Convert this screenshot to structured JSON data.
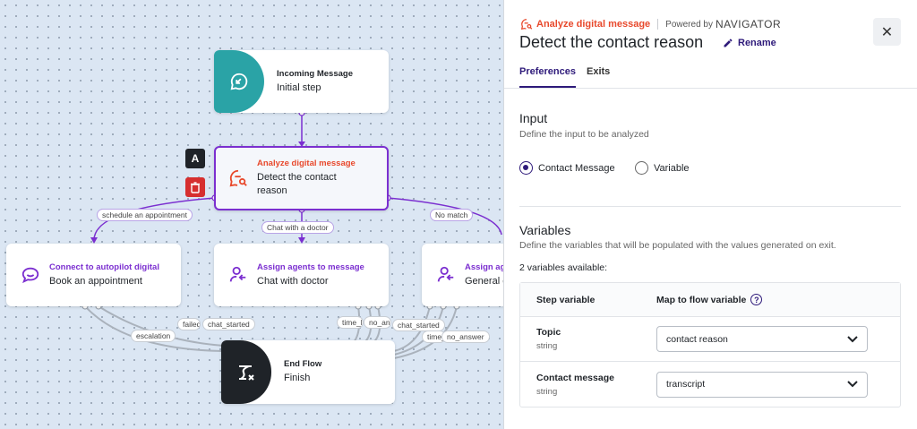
{
  "canvas": {
    "nodes": {
      "incoming": {
        "label": "Incoming Message",
        "title": "Initial step"
      },
      "analyze": {
        "label": "Analyze digital message",
        "title": "Detect the contact reason"
      },
      "autopilot": {
        "label": "Connect to autopilot digital",
        "title": "Book an appointment"
      },
      "assign_doctor": {
        "label": "Assign agents to message",
        "title": "Chat with doctor"
      },
      "assign_general": {
        "label": "Assign agents to message",
        "title": "General chat"
      },
      "end": {
        "label": "End Flow",
        "title": "Finish"
      }
    },
    "edge_labels": {
      "schedule": "schedule an appointment",
      "chat_doctor": "Chat with a doctor",
      "no_match": "No match",
      "escalation": "escalation",
      "failed": "failed",
      "chat_started_1": "chat_started",
      "time_left": "time_left",
      "no_answer_1": "no_answer",
      "chat_started_2": "chat_started",
      "time_2": "time_left",
      "no_answer_2": "no_answer"
    },
    "tools": {
      "label_button": "A"
    },
    "colors": {
      "accent": "#e8492c",
      "purple": "#7b2fd0",
      "teal": "#2aa3a6",
      "dark": "#1f2328",
      "danger": "#d62f2f"
    }
  },
  "panel": {
    "breadcrumb": {
      "step_type": "Analyze digital message",
      "powered_by": "Powered by",
      "brand": "NAVIGATOR"
    },
    "title": "Detect the contact reason",
    "rename_label": "Rename",
    "close_label": "✕",
    "tabs": [
      {
        "label": "Preferences",
        "active": true
      },
      {
        "label": "Exits",
        "active": false
      }
    ],
    "input": {
      "title": "Input",
      "description": "Define the input to be analyzed",
      "options": [
        {
          "label": "Contact Message",
          "selected": true
        },
        {
          "label": "Variable",
          "selected": false
        }
      ]
    },
    "variables": {
      "title": "Variables",
      "description": "Define the variables that will be populated with the values generated on exit.",
      "count_text": "2 variables available:",
      "headers": {
        "step_variable": "Step variable",
        "map_to": "Map to flow variable"
      },
      "rows": [
        {
          "name": "Topic",
          "type": "string",
          "mapped": "contact reason"
        },
        {
          "name": "Contact message",
          "type": "string",
          "mapped": "transcript"
        }
      ]
    }
  }
}
